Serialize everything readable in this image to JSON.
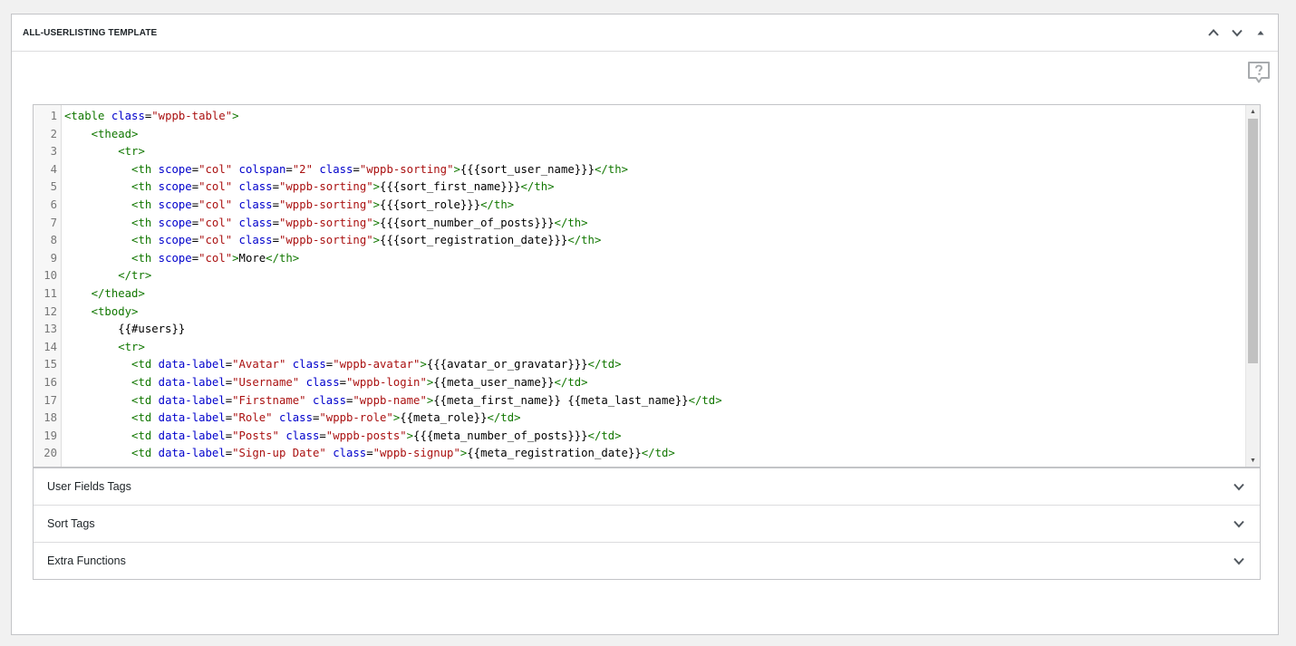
{
  "postbox": {
    "title": "ALL-USERLISTING TEMPLATE"
  },
  "editor": {
    "line_numbers": [
      "1",
      "2",
      "3",
      "4",
      "5",
      "6",
      "7",
      "8",
      "9",
      "10",
      "11",
      "12",
      "13",
      "14",
      "15",
      "16",
      "17",
      "18",
      "19",
      "20"
    ],
    "lines": [
      [
        [
          "tag",
          "<table "
        ],
        [
          "attr",
          "class"
        ],
        [
          "txt",
          "="
        ],
        [
          "str",
          "\"wppb-table\""
        ],
        [
          "tag",
          ">"
        ]
      ],
      [
        [
          "txt",
          "    "
        ],
        [
          "tag",
          "<thead>"
        ]
      ],
      [
        [
          "txt",
          "        "
        ],
        [
          "tag",
          "<tr>"
        ]
      ],
      [
        [
          "txt",
          "          "
        ],
        [
          "tag",
          "<th "
        ],
        [
          "attr",
          "scope"
        ],
        [
          "txt",
          "="
        ],
        [
          "str",
          "\"col\""
        ],
        [
          "txt",
          " "
        ],
        [
          "attr",
          "colspan"
        ],
        [
          "txt",
          "="
        ],
        [
          "str",
          "\"2\""
        ],
        [
          "txt",
          " "
        ],
        [
          "attr",
          "class"
        ],
        [
          "txt",
          "="
        ],
        [
          "str",
          "\"wppb-sorting\""
        ],
        [
          "tag",
          ">"
        ],
        [
          "txt",
          "{{{sort_user_name}}}"
        ],
        [
          "tag",
          "</th>"
        ]
      ],
      [
        [
          "txt",
          "          "
        ],
        [
          "tag",
          "<th "
        ],
        [
          "attr",
          "scope"
        ],
        [
          "txt",
          "="
        ],
        [
          "str",
          "\"col\""
        ],
        [
          "txt",
          " "
        ],
        [
          "attr",
          "class"
        ],
        [
          "txt",
          "="
        ],
        [
          "str",
          "\"wppb-sorting\""
        ],
        [
          "tag",
          ">"
        ],
        [
          "txt",
          "{{{sort_first_name}}}"
        ],
        [
          "tag",
          "</th>"
        ]
      ],
      [
        [
          "txt",
          "          "
        ],
        [
          "tag",
          "<th "
        ],
        [
          "attr",
          "scope"
        ],
        [
          "txt",
          "="
        ],
        [
          "str",
          "\"col\""
        ],
        [
          "txt",
          " "
        ],
        [
          "attr",
          "class"
        ],
        [
          "txt",
          "="
        ],
        [
          "str",
          "\"wppb-sorting\""
        ],
        [
          "tag",
          ">"
        ],
        [
          "txt",
          "{{{sort_role}}}"
        ],
        [
          "tag",
          "</th>"
        ]
      ],
      [
        [
          "txt",
          "          "
        ],
        [
          "tag",
          "<th "
        ],
        [
          "attr",
          "scope"
        ],
        [
          "txt",
          "="
        ],
        [
          "str",
          "\"col\""
        ],
        [
          "txt",
          " "
        ],
        [
          "attr",
          "class"
        ],
        [
          "txt",
          "="
        ],
        [
          "str",
          "\"wppb-sorting\""
        ],
        [
          "tag",
          ">"
        ],
        [
          "txt",
          "{{{sort_number_of_posts}}}"
        ],
        [
          "tag",
          "</th>"
        ]
      ],
      [
        [
          "txt",
          "          "
        ],
        [
          "tag",
          "<th "
        ],
        [
          "attr",
          "scope"
        ],
        [
          "txt",
          "="
        ],
        [
          "str",
          "\"col\""
        ],
        [
          "txt",
          " "
        ],
        [
          "attr",
          "class"
        ],
        [
          "txt",
          "="
        ],
        [
          "str",
          "\"wppb-sorting\""
        ],
        [
          "tag",
          ">"
        ],
        [
          "txt",
          "{{{sort_registration_date}}}"
        ],
        [
          "tag",
          "</th>"
        ]
      ],
      [
        [
          "txt",
          "          "
        ],
        [
          "tag",
          "<th "
        ],
        [
          "attr",
          "scope"
        ],
        [
          "txt",
          "="
        ],
        [
          "str",
          "\"col\""
        ],
        [
          "tag",
          ">"
        ],
        [
          "txt",
          "More"
        ],
        [
          "tag",
          "</th>"
        ]
      ],
      [
        [
          "txt",
          "        "
        ],
        [
          "tag",
          "</tr>"
        ]
      ],
      [
        [
          "txt",
          "    "
        ],
        [
          "tag",
          "</thead>"
        ]
      ],
      [
        [
          "txt",
          "    "
        ],
        [
          "tag",
          "<tbody>"
        ]
      ],
      [
        [
          "txt",
          "        {{#users}}"
        ]
      ],
      [
        [
          "txt",
          "        "
        ],
        [
          "tag",
          "<tr>"
        ]
      ],
      [
        [
          "txt",
          "          "
        ],
        [
          "tag",
          "<td "
        ],
        [
          "attr",
          "data-label"
        ],
        [
          "txt",
          "="
        ],
        [
          "str",
          "\"Avatar\""
        ],
        [
          "txt",
          " "
        ],
        [
          "attr",
          "class"
        ],
        [
          "txt",
          "="
        ],
        [
          "str",
          "\"wppb-avatar\""
        ],
        [
          "tag",
          ">"
        ],
        [
          "txt",
          "{{{avatar_or_gravatar}}}"
        ],
        [
          "tag",
          "</td>"
        ]
      ],
      [
        [
          "txt",
          "          "
        ],
        [
          "tag",
          "<td "
        ],
        [
          "attr",
          "data-label"
        ],
        [
          "txt",
          "="
        ],
        [
          "str",
          "\"Username\""
        ],
        [
          "txt",
          " "
        ],
        [
          "attr",
          "class"
        ],
        [
          "txt",
          "="
        ],
        [
          "str",
          "\"wppb-login\""
        ],
        [
          "tag",
          ">"
        ],
        [
          "txt",
          "{{meta_user_name}}"
        ],
        [
          "tag",
          "</td>"
        ]
      ],
      [
        [
          "txt",
          "          "
        ],
        [
          "tag",
          "<td "
        ],
        [
          "attr",
          "data-label"
        ],
        [
          "txt",
          "="
        ],
        [
          "str",
          "\"Firstname\""
        ],
        [
          "txt",
          " "
        ],
        [
          "attr",
          "class"
        ],
        [
          "txt",
          "="
        ],
        [
          "str",
          "\"wppb-name\""
        ],
        [
          "tag",
          ">"
        ],
        [
          "txt",
          "{{meta_first_name}} {{meta_last_name}}"
        ],
        [
          "tag",
          "</td>"
        ]
      ],
      [
        [
          "txt",
          "          "
        ],
        [
          "tag",
          "<td "
        ],
        [
          "attr",
          "data-label"
        ],
        [
          "txt",
          "="
        ],
        [
          "str",
          "\"Role\""
        ],
        [
          "txt",
          " "
        ],
        [
          "attr",
          "class"
        ],
        [
          "txt",
          "="
        ],
        [
          "str",
          "\"wppb-role\""
        ],
        [
          "tag",
          ">"
        ],
        [
          "txt",
          "{{meta_role}}"
        ],
        [
          "tag",
          "</td>"
        ]
      ],
      [
        [
          "txt",
          "          "
        ],
        [
          "tag",
          "<td "
        ],
        [
          "attr",
          "data-label"
        ],
        [
          "txt",
          "="
        ],
        [
          "str",
          "\"Posts\""
        ],
        [
          "txt",
          " "
        ],
        [
          "attr",
          "class"
        ],
        [
          "txt",
          "="
        ],
        [
          "str",
          "\"wppb-posts\""
        ],
        [
          "tag",
          ">"
        ],
        [
          "txt",
          "{{{meta_number_of_posts}}}"
        ],
        [
          "tag",
          "</td>"
        ]
      ],
      [
        [
          "txt",
          "          "
        ],
        [
          "tag",
          "<td "
        ],
        [
          "attr",
          "data-label"
        ],
        [
          "txt",
          "="
        ],
        [
          "str",
          "\"Sign-up Date\""
        ],
        [
          "txt",
          " "
        ],
        [
          "attr",
          "class"
        ],
        [
          "txt",
          "="
        ],
        [
          "str",
          "\"wppb-signup\""
        ],
        [
          "tag",
          ">"
        ],
        [
          "txt",
          "{{meta_registration_date}}"
        ],
        [
          "tag",
          "</td>"
        ]
      ]
    ]
  },
  "accordion": {
    "items": [
      {
        "label": "User Fields Tags"
      },
      {
        "label": "Sort Tags"
      },
      {
        "label": "Extra Functions"
      }
    ]
  },
  "icons": {
    "move_up": "chevron-up-icon",
    "move_down": "chevron-down-icon",
    "toggle": "triangle-up-icon",
    "help": "help-question-icon"
  }
}
